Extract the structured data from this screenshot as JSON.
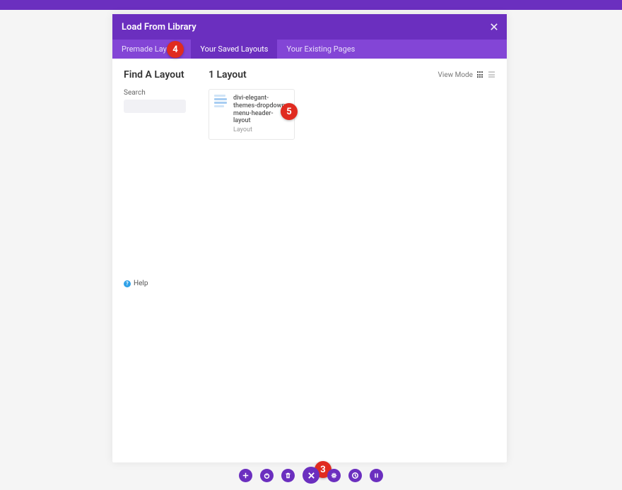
{
  "modal": {
    "title": "Load From Library",
    "tabs": [
      {
        "label": "Premade Layouts"
      },
      {
        "label": "Your Saved Layouts"
      },
      {
        "label": "Your Existing Pages"
      }
    ]
  },
  "sidebar": {
    "heading": "Find A Layout",
    "search_label": "Search",
    "search_value": "",
    "help_label": "Help"
  },
  "content": {
    "heading": "1 Layout",
    "view_mode_label": "View Mode",
    "layouts": [
      {
        "name": "divi-elegant-themes-dropdown-menu-header-layout",
        "type": "Layout"
      }
    ]
  },
  "badges": {
    "b3": "3",
    "b4": "4",
    "b5": "5"
  },
  "toolbar": {
    "add": "+",
    "power": "power",
    "trash": "trash",
    "close": "close",
    "settings": "settings",
    "clock": "clock",
    "pause": "pause"
  }
}
